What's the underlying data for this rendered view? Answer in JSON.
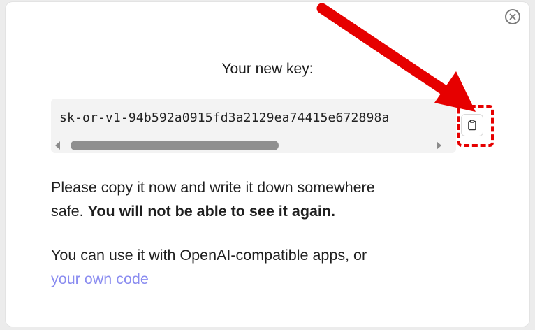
{
  "dialog": {
    "title": "Your new key:",
    "key_value": "sk-or-v1-94b592a0915fd3a2129ea74415e672898a",
    "message_line1": "Please copy it now and write it down somewhere",
    "message_line2_prefix": "safe. ",
    "message_bold": "You will not be able to see it again.",
    "usage_text": "You can use it with OpenAI-compatible apps, or",
    "usage_link": "your own code"
  },
  "icons": {
    "close": "close-icon",
    "copy": "clipboard-icon",
    "scroll_left": "scroll-left-arrow",
    "scroll_right": "scroll-right-arrow"
  },
  "annotation": {
    "color": "#e60000",
    "style": "red arrow pointing to dashed box around copy button"
  },
  "colors": {
    "link": "#8a8cf0",
    "key_box_bg": "#f3f3f3"
  }
}
